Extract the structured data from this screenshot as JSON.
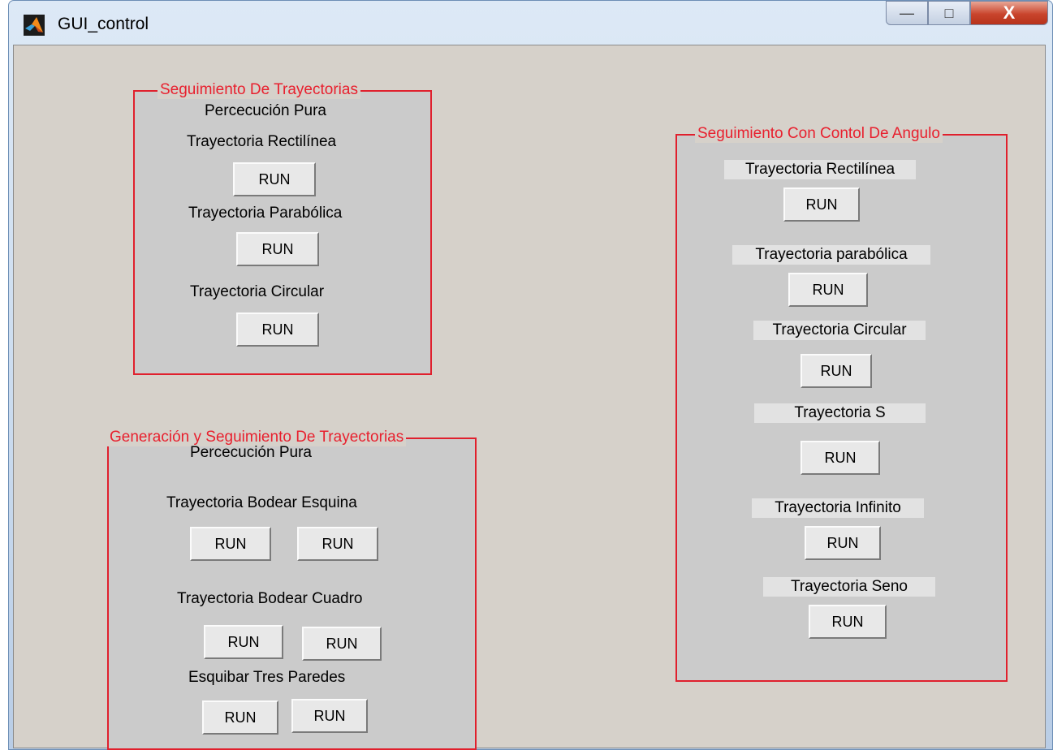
{
  "window": {
    "title": "GUI_control",
    "controls": {
      "minimize": "—",
      "maximize": "□",
      "close": "X"
    }
  },
  "icons": {
    "app": "matlab-logo-icon"
  },
  "colors": {
    "frame_border": "#e0202d",
    "legend_text": "#e8202e",
    "panel_bg": "#cbcbcb",
    "client_bg": "#d6d1ca"
  },
  "panel1": {
    "title": "Seguimiento De Trayectorias",
    "subtitle": "Percecución Pura",
    "rectilinea": "Trayectoria Rectilínea",
    "parabolica": "Trayectoria Parabólica",
    "circular": "Trayectoria Circular",
    "run": "RUN"
  },
  "panel2": {
    "title": "Generación y Seguimiento De Trayectorias",
    "subtitle": "Percecución Pura",
    "esquina": "Trayectoria Bodear Esquina",
    "cuadro": "Trayectoria Bodear Cuadro",
    "paredes": "Esquibar Tres Paredes",
    "run": "RUN"
  },
  "panel3": {
    "title": "Seguimiento Con Contol De Angulo",
    "rectilinea": "Trayectoria Rectilínea",
    "parabolica": "Trayectoria parabólica",
    "circular": "Trayectoria Circular",
    "s": "Trayectoria S",
    "infinito": "Trayectoria Infinito",
    "seno": "Trayectoria Seno",
    "run": "RUN"
  }
}
